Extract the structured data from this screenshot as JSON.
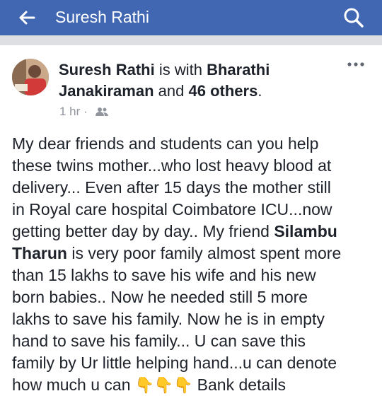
{
  "topbar": {
    "title": "Suresh Rathi"
  },
  "post": {
    "author": "Suresh Rathi",
    "with_text": "is with",
    "tagged": "Bharathi Janakiraman",
    "and_text": "and",
    "others": "46 others",
    "period": ".",
    "time": "1 hr",
    "separator": "·",
    "lines": [
      {
        "a": "My dear friends and students can you help"
      },
      {
        "a": "these twins mother...who lost heavy blood at"
      },
      {
        "a": "delivery... Even after 15 days the mother still"
      },
      {
        "a": "in Royal care hospital Coimbatore ICU...now"
      },
      {
        "a": "getting better day by day.. My friend ",
        "b": "Silambu"
      },
      {
        "b": "Tharun",
        "a": " is very poor family almost spent more"
      },
      {
        "a": "than 15 lakhs to save his wife and his new"
      },
      {
        "a": "born babies.. Now he needed still 5 more"
      },
      {
        "a": "lakhs to save his family. Now he is in empty"
      },
      {
        "a": "hand to save his family... U can save this"
      },
      {
        "a": "family by Ur little helping hand...u can denote"
      },
      {
        "a": "how much u can",
        "emoji": "👇👇👇",
        "c": "Bank details"
      }
    ]
  },
  "icons": {
    "back": "arrow-left-icon",
    "search": "search-icon",
    "more": "more-horizontal-icon",
    "audience": "friends-icon"
  },
  "colors": {
    "brand": "#4267b2",
    "meta": "#90949c",
    "text": "#1d2129"
  }
}
